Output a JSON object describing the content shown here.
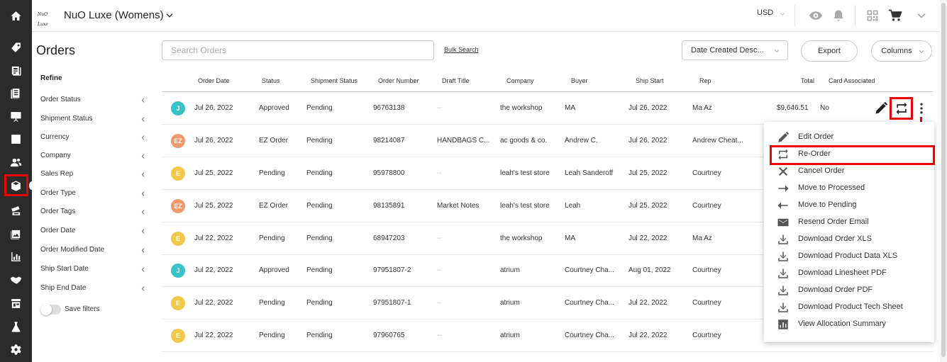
{
  "header": {
    "logo_text": "NuO Luxe",
    "brand": "NuO Luxe (Womens)",
    "currency": "USD"
  },
  "sidebar": {
    "title": "Orders",
    "refine": "Refine",
    "filters": [
      "Order Status",
      "Shipment Status",
      "Currency",
      "Company",
      "Sales Rep",
      "Order Type",
      "Order Tags",
      "Order Date",
      "Order Modified Date",
      "Ship Start Date",
      "Ship End Date"
    ],
    "save_filters": "Save filters"
  },
  "toolbar": {
    "search_placeholder": "Search Orders",
    "bulk_search": "Bulk Search",
    "sort": "Date Created Desc...",
    "export": "Export",
    "columns": "Columns"
  },
  "table": {
    "headers": [
      "Order Date",
      "Status",
      "Shipment Status",
      "Order Number",
      "Draft Title",
      "Company",
      "Buyer",
      "Ship Start",
      "Rep",
      "Total",
      "Card Associated"
    ],
    "rows": [
      {
        "icon": "teal",
        "glyph": "J",
        "order_date": "Jul 26, 2022",
        "status": "Approved",
        "shipment": "Pending",
        "number": "96763138",
        "draft": "--",
        "company": "the workshop",
        "buyer": "MA",
        "ship_start": "Jul 26, 2022",
        "rep": "Ma Az",
        "total": "$9,646.51",
        "card": "No"
      },
      {
        "icon": "orange",
        "glyph": "EZ",
        "order_date": "Jul 26, 2022",
        "status": "EZ Order",
        "shipment": "Pending",
        "number": "98214087",
        "draft": "HANDBAGS C...",
        "company": "ac goods & co.",
        "buyer": "Andrew C.",
        "ship_start": "Jul 26, 2022",
        "rep": "Andrew Cheat...",
        "total": "",
        "card": ""
      },
      {
        "icon": "yellow",
        "glyph": "E",
        "order_date": "Jul 25, 2022",
        "status": "Pending",
        "shipment": "Pending",
        "number": "95978800",
        "draft": "--",
        "company": "leah's test store",
        "buyer": "Leah Sanderoff",
        "ship_start": "Jul 25, 2022",
        "rep": "Courtney",
        "total": "",
        "card": ""
      },
      {
        "icon": "orange",
        "glyph": "EZ",
        "order_date": "Jul 25, 2022",
        "status": "EZ Order",
        "shipment": "Pending",
        "number": "98135891",
        "draft": "Market Notes",
        "company": "leah's test store",
        "buyer": "Leah",
        "ship_start": "Jul 25, 2022",
        "rep": "Courtney",
        "total": "",
        "card": ""
      },
      {
        "icon": "yellow",
        "glyph": "E",
        "order_date": "Jul 22, 2022",
        "status": "Pending",
        "shipment": "Pending",
        "number": "68947203",
        "draft": "--",
        "company": "the workshop",
        "buyer": "MA",
        "ship_start": "Jul 22, 2022",
        "rep": "Ma Az",
        "total": "",
        "card": ""
      },
      {
        "icon": "teal",
        "glyph": "J",
        "order_date": "Jul 22, 2022",
        "status": "Approved",
        "shipment": "Pending",
        "number": "97951807-2",
        "draft": "--",
        "company": "atrium",
        "buyer": "Courtney Cha...",
        "ship_start": "Aug 01, 2022",
        "rep": "Courtney",
        "total": "",
        "card": ""
      },
      {
        "icon": "yellow",
        "glyph": "E",
        "order_date": "Jul 22, 2022",
        "status": "Pending",
        "shipment": "Pending",
        "number": "97951807-1",
        "draft": "--",
        "company": "atrium",
        "buyer": "Courtney Cha...",
        "ship_start": "Jul 22, 2022",
        "rep": "Courtney",
        "total": "",
        "card": ""
      },
      {
        "icon": "yellow",
        "glyph": "E",
        "order_date": "Jul 22, 2022",
        "status": "Pending",
        "shipment": "Pending",
        "number": "97960765",
        "draft": "--",
        "company": "atrium",
        "buyer": "Courtney Cha...",
        "ship_start": "Jul 22, 2022",
        "rep": "Courtney",
        "total": "",
        "card": ""
      }
    ]
  },
  "menu": {
    "items": [
      {
        "label": "Edit Order",
        "icon": "pencil-icon"
      },
      {
        "label": "Re-Order",
        "icon": "reorder-icon"
      },
      {
        "label": "Cancel Order",
        "icon": "close-icon"
      },
      {
        "label": "Move to Processed",
        "icon": "arrow-right-icon"
      },
      {
        "label": "Move to Pending",
        "icon": "arrow-left-icon"
      },
      {
        "label": "Resend Order Email",
        "icon": "envelope-icon"
      },
      {
        "label": "Download Order XLS",
        "icon": "download-icon"
      },
      {
        "label": "Download Product Data XLS",
        "icon": "download-icon"
      },
      {
        "label": "Download Linesheet PDF",
        "icon": "download-icon"
      },
      {
        "label": "Download Order PDF",
        "icon": "download-icon"
      },
      {
        "label": "Download Product Tech Sheet",
        "icon": "download-icon"
      },
      {
        "label": "View Allocation Summary",
        "icon": "bar-chart-icon"
      }
    ]
  },
  "colors": {
    "rail": "#2b2b2b",
    "highlight": "#ee0000",
    "teal": "#38c3c9",
    "orange": "#f09a6c",
    "yellow": "#f2c84b"
  }
}
